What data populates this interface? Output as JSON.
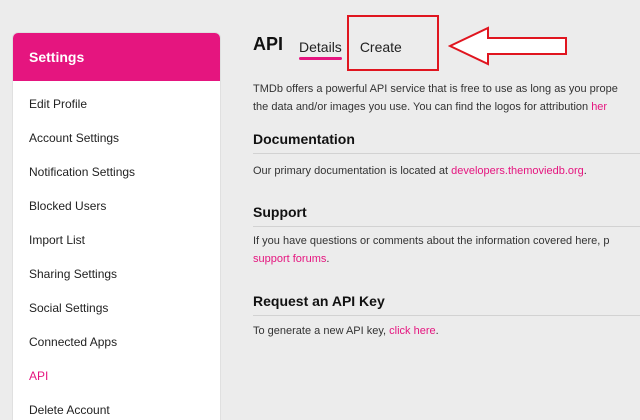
{
  "sidebar": {
    "header": "Settings",
    "items": [
      {
        "label": "Edit Profile"
      },
      {
        "label": "Account Settings"
      },
      {
        "label": "Notification Settings"
      },
      {
        "label": "Blocked Users"
      },
      {
        "label": "Import List"
      },
      {
        "label": "Sharing Settings"
      },
      {
        "label": "Social Settings"
      },
      {
        "label": "Connected Apps"
      },
      {
        "label": "API"
      },
      {
        "label": "Delete Account"
      }
    ],
    "active_item": "API"
  },
  "main": {
    "title": "API",
    "tabs": [
      {
        "label": "Details",
        "active": true
      },
      {
        "label": "Create",
        "active": false
      }
    ],
    "intro_line1": "TMDb offers a powerful API service that is free to use as long as you prope",
    "intro_line2_text": "the data and/or images you use. You can find the logos for attribution ",
    "intro_line2_link": "her",
    "sections": {
      "documentation": {
        "title": "Documentation",
        "text": "Our primary documentation is located at ",
        "link": "developers.themoviedb.org",
        "after": "."
      },
      "support": {
        "title": "Support",
        "text": "If you have questions or comments about the information covered here, p",
        "link": "support forums",
        "after": "."
      },
      "request": {
        "title": "Request an API Key",
        "text": "To generate a new API key, ",
        "link": "click here",
        "after": "."
      }
    }
  },
  "colors": {
    "accent": "#e5157f",
    "annotation": "#e0151f",
    "background": "#ececec"
  }
}
